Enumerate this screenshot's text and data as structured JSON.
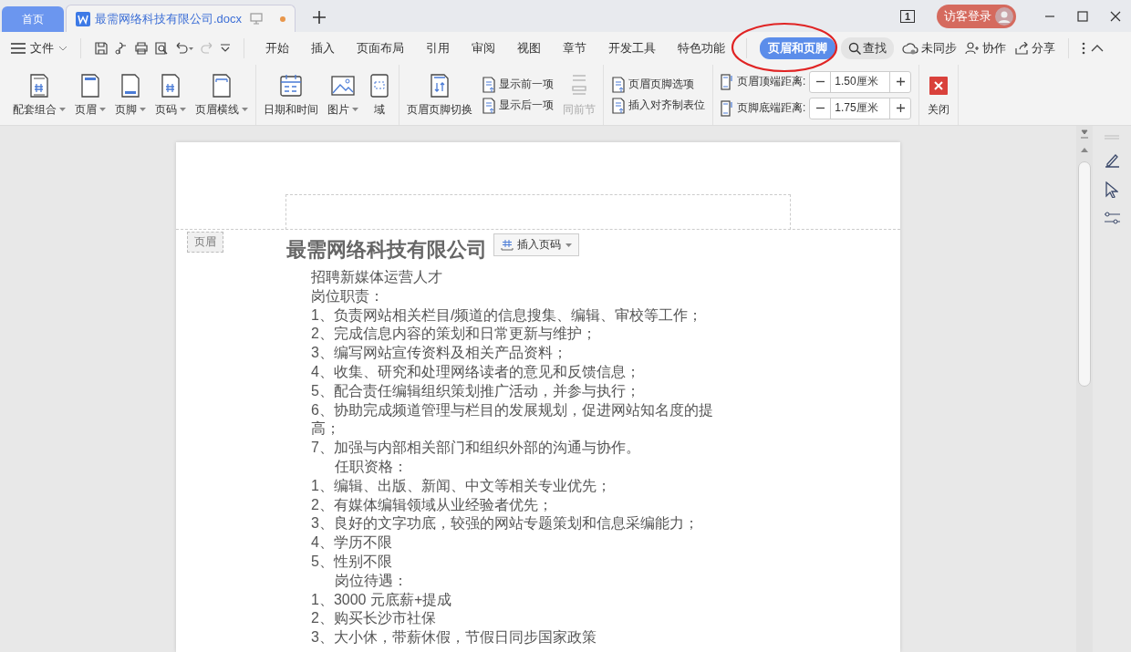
{
  "tabs": [
    {
      "label": "首页",
      "kind": "home",
      "selected": false
    },
    {
      "label": "最需网络科技有限公司.docx",
      "kind": "document",
      "selected": true,
      "unsaved": true
    }
  ],
  "window": {
    "page_count": "1",
    "account": "访客登录"
  },
  "menu": {
    "file": "文件",
    "tabs": [
      {
        "label": "开始",
        "selected": false
      },
      {
        "label": "插入",
        "selected": false
      },
      {
        "label": "页面布局",
        "selected": false
      },
      {
        "label": "引用",
        "selected": false
      },
      {
        "label": "审阅",
        "selected": false
      },
      {
        "label": "视图",
        "selected": false
      },
      {
        "label": "章节",
        "selected": false
      },
      {
        "label": "开发工具",
        "selected": false
      },
      {
        "label": "特色功能",
        "selected": false
      },
      {
        "label": "页眉和页脚",
        "selected": true
      }
    ],
    "search": "查找",
    "actions": [
      "未同步",
      "协作",
      "分享"
    ]
  },
  "ribbon": [
    {
      "items": [
        {
          "kind": "big",
          "label": "配套组合",
          "dropdown": true,
          "disabled": false
        },
        {
          "kind": "big",
          "label": "页眉",
          "dropdown": true,
          "disabled": false
        },
        {
          "kind": "big",
          "label": "页脚",
          "dropdown": true,
          "disabled": false
        },
        {
          "kind": "big",
          "label": "页码",
          "dropdown": true,
          "disabled": false
        },
        {
          "kind": "big",
          "label": "页眉横线",
          "dropdown": true,
          "disabled": false
        }
      ]
    },
    {
      "items": [
        {
          "kind": "big",
          "label": "日期和时间",
          "dropdown": false,
          "disabled": false
        },
        {
          "kind": "big",
          "label": "图片",
          "dropdown": true,
          "disabled": false
        },
        {
          "kind": "big",
          "label": "域",
          "dropdown": false,
          "disabled": false
        }
      ]
    },
    {
      "items": [
        {
          "kind": "big",
          "label": "页眉页脚切换",
          "dropdown": false,
          "disabled": false
        },
        {
          "kind": "stack",
          "items": [
            "显示前一项",
            "显示后一项"
          ]
        },
        {
          "kind": "big",
          "label": "同前节",
          "dropdown": false,
          "disabled": true
        }
      ]
    },
    {
      "items": [
        {
          "kind": "stack",
          "items": [
            "页眉页脚选项",
            "插入对齐制表位"
          ]
        }
      ]
    },
    {
      "items": [
        {
          "kind": "spinners",
          "items": [
            {
              "label": "页眉顶端距离:",
              "value": "1.50厘米"
            },
            {
              "label": "页脚底端距离:",
              "value": "1.75厘米"
            }
          ]
        }
      ]
    },
    {
      "items": [
        {
          "kind": "close",
          "label": "关闭"
        }
      ]
    }
  ],
  "document": {
    "header_label": "页眉",
    "insert_page_number": "插入页码",
    "title": "最需网络科技有限公司",
    "lines": [
      {
        "text": "招聘新媒体运营人才",
        "indent": false
      },
      {
        "text": "岗位职责：",
        "indent": false
      },
      {
        "text": "1、负责网站相关栏目/频道的信息搜集、编辑、审校等工作；",
        "indent": false
      },
      {
        "text": "2、完成信息内容的策划和日常更新与维护；",
        "indent": false
      },
      {
        "text": "3、编写网站宣传资料及相关产品资料；",
        "indent": false
      },
      {
        "text": "4、收集、研究和处理网络读者的意见和反馈信息；",
        "indent": false
      },
      {
        "text": "5、配合责任编辑组织策划推广活动，并参与执行；",
        "indent": false
      },
      {
        "text": "6、协助完成频道管理与栏目的发展规划，促进网站知名度的提",
        "indent": false
      },
      {
        "text": "高；",
        "indent": false
      },
      {
        "text": "7、加强与内部相关部门和组织外部的沟通与协作。",
        "indent": false
      },
      {
        "text": "任职资格：",
        "indent": true
      },
      {
        "text": "1、编辑、出版、新闻、中文等相关专业优先；",
        "indent": false
      },
      {
        "text": "2、有媒体编辑领域从业经验者优先；",
        "indent": false
      },
      {
        "text": "3、良好的文字功底，较强的网站专题策划和信息采编能力；",
        "indent": false
      },
      {
        "text": "4、学历不限",
        "indent": false
      },
      {
        "text": "5、性别不限",
        "indent": false
      },
      {
        "text": "岗位待遇：",
        "indent": true
      },
      {
        "text": "1、3000 元底薪+提成",
        "indent": false
      },
      {
        "text": "2、购买长沙市社保",
        "indent": false
      },
      {
        "text": "3、大小休，带薪休假，节假日同步国家政策",
        "indent": false
      }
    ]
  }
}
